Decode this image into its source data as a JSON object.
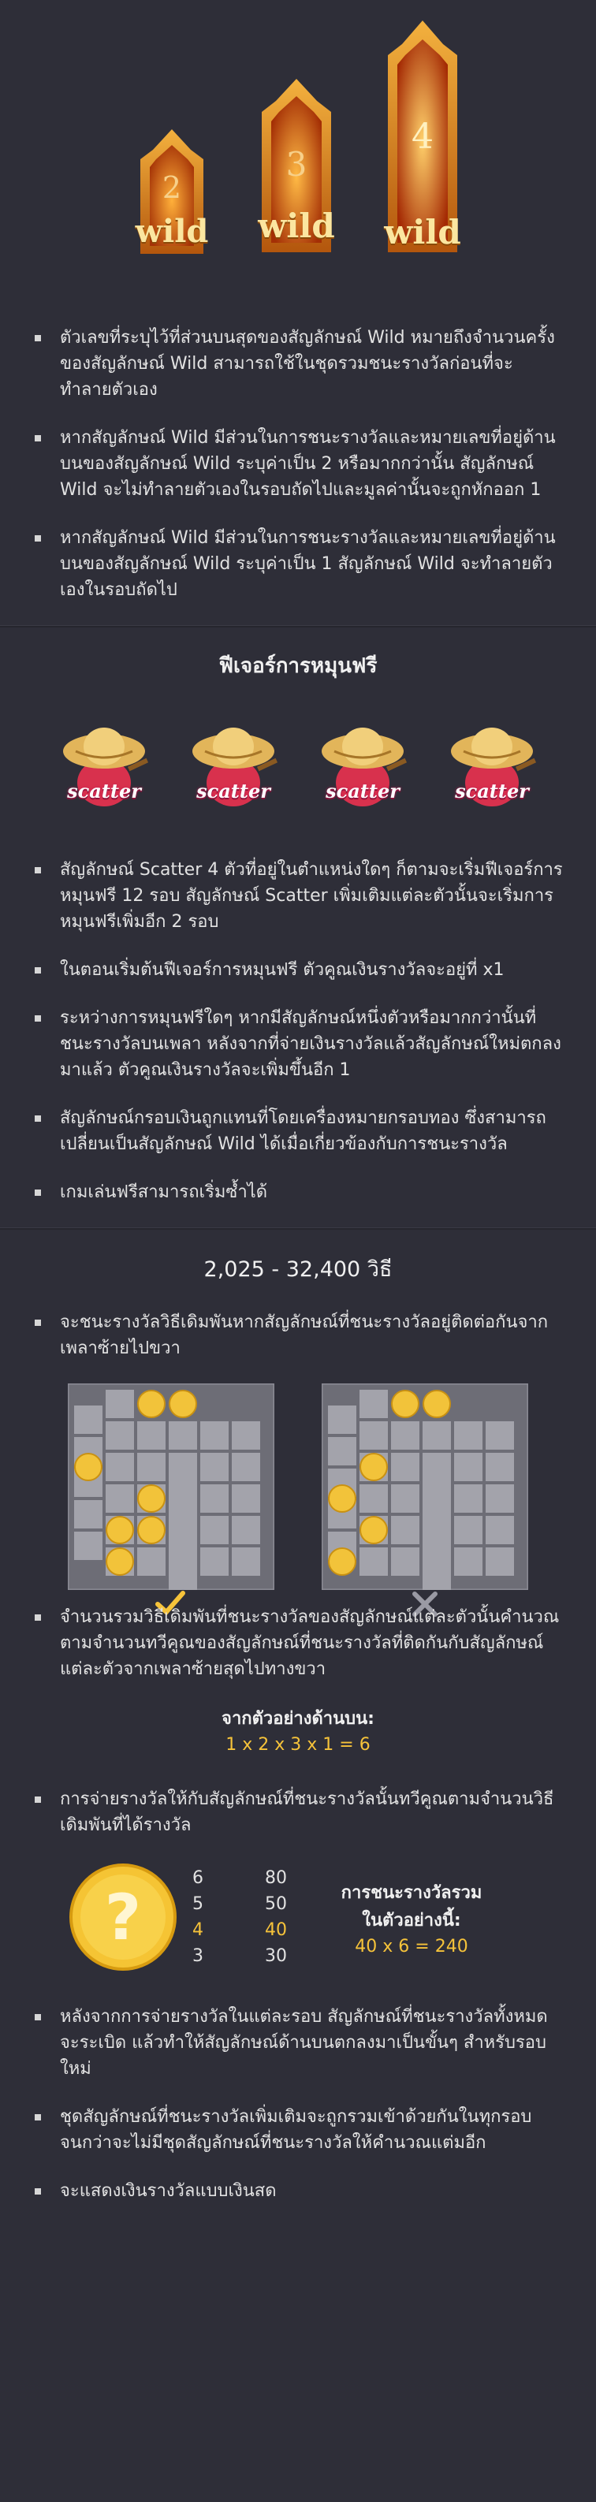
{
  "wild_section": {
    "symbols": [
      {
        "number": "2",
        "label": "wild"
      },
      {
        "number": "3",
        "label": "wild"
      },
      {
        "number": "4",
        "label": "wild"
      }
    ],
    "bullets": [
      "ตัวเลขที่ระบุไว้ที่ส่วนบนสุดของสัญลักษณ์ Wild หมายถึงจำนวนครั้งของสัญลักษณ์ Wild สามารถใช้ในชุดรวมชนะรางวัลก่อนที่จะทำลายตัวเอง",
      "หากสัญลักษณ์ Wild มีส่วนในการชนะรางวัลและหมายเลขที่อยู่ด้านบนของสัญลักษณ์ Wild ระบุค่าเป็น 2 หรือมากกว่านั้น สัญลักษณ์ Wild จะไม่ทำลายตัวเองในรอบถัดไปและมูลค่านั้นจะถูกหักออก 1",
      "หากสัญลักษณ์ Wild มีส่วนในการชนะรางวัลและหมายเลขที่อยู่ด้านบนของสัญลักษณ์ Wild ระบุค่าเป็น 1 สัญลักษณ์ Wild จะทำลายตัวเองในรอบถัดไป"
    ]
  },
  "free_spins": {
    "title": "ฟีเจอร์การหมุนฟรี",
    "scatter_label": "scatter",
    "bullets": [
      "สัญลักษณ์ Scatter 4 ตัวที่อยู่ในตำแหน่งใดๆ ก็ตามจะเริ่มฟีเจอร์การหมุนฟรี 12 รอบ สัญลักษณ์ Scatter เพิ่มเติมแต่ละตัวนั้นจะเริ่มการหมุนฟรีเพิ่มอีก 2 รอบ",
      "ในตอนเริ่มต้นฟีเจอร์การหมุนฟรี ตัวคูณเงินรางวัลจะอยู่ที่ x1",
      "ระหว่างการหมุนฟรีใดๆ หากมีสัญลักษณ์หนึ่งตัวหรือมากกว่านั้นที่ชนะรางวัลบนเพลา หลังจากที่จ่ายเงินรางวัลแล้วสัญลักษณ์ใหม่ตกลงมาแล้ว ตัวคูณเงินรางวัลจะเพิ่มขึ้นอีก 1",
      "สัญลักษณ์กรอบเงินถูกแทนที่โดยเครื่องหมายกรอบทอง ซึ่งสามารถเปลี่ยนเป็นสัญลักษณ์ Wild ได้เมื่อเกี่ยวข้องกับการชนะรางวัล",
      "เกมเล่นฟรีสามารถเริ่มซ้ำได้"
    ]
  },
  "ways": {
    "title": "2,025 - 32,400 วิธี",
    "bullets_top": [
      "จะชนะรางวัลวิธีเดิมพันหากสัญลักษณ์ที่ชนะรางวัลอยู่ติดต่อกันจากเพลาซ้ายไปขวา"
    ],
    "bullets_mid": [
      "จำนวนรวมวิธีเดิมพันที่ชนะรางวัลของสัญลักษณ์แต่ละตัวนั้นคำนวณตามจำนวนทวีคูณของสัญลักษณ์ที่ชนะรางวัลที่ติดกันกับสัญลักษณ์แต่ละตัวจากเพลาซ้ายสุดไปทางขวา"
    ],
    "example_title": "จากตัวอย่างด้านบน:",
    "example_value": "1 x 2 x 3 x 1 = 6",
    "bullets_pay": [
      "การจ่ายรางวัลให้กับสัญลักษณ์ที่ชนะรางวัลนั้นทวีคูณตามจำนวนวิธีเดิมพันที่ได้รางวัล"
    ],
    "paytable": [
      {
        "count": "6",
        "pay": "80",
        "highlight": false
      },
      {
        "count": "5",
        "pay": "50",
        "highlight": false
      },
      {
        "count": "4",
        "pay": "40",
        "highlight": true
      },
      {
        "count": "3",
        "pay": "30",
        "highlight": false
      }
    ],
    "win_title": "การชนะรางวัลรวมในตัวอย่างนี้:",
    "win_value": "40 x 6 = 240",
    "bullets_bottom": [
      "หลังจากการจ่ายรางวัลในแต่ละรอบ สัญลักษณ์ที่ชนะรางวัลทั้งหมดจะระเบิด แล้วทำให้สัญลักษณ์ด้านบนตกลงมาเป็นขั้นๆ สำหรับรอบใหม่",
      "ชุดสัญลักษณ์ที่ชนะรางวัลเพิ่มเติมจะถูกรวมเข้าด้วยกันในทุกรอบจนกว่าจะไม่มีชุดสัญลักษณ์ที่ชนะรางวัลให้คำนวณแต่มอีก",
      "จะแสดงเงินรางวัลแบบเงินสด"
    ]
  },
  "colors": {
    "background": "#2e2e38",
    "accent": "#f6c33a",
    "check": "#f6c33a",
    "cross": "#9a9aa4"
  }
}
